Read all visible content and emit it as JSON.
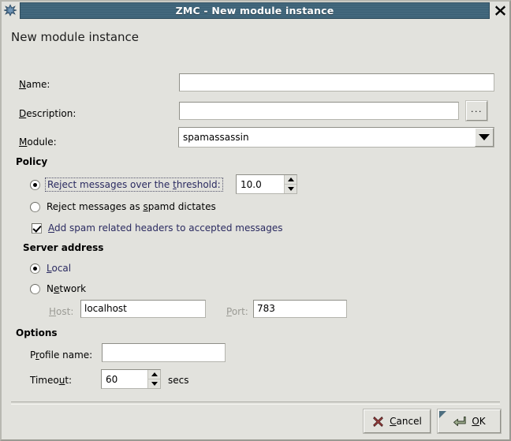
{
  "window": {
    "title": "ZMC - New module instance",
    "icon": "module-icon",
    "close_label": "close-icon"
  },
  "heading": "New module instance",
  "fields": {
    "name": {
      "label_pre": "",
      "label_acc": "N",
      "label_post": "ame:",
      "value": "",
      "placeholder": ""
    },
    "description": {
      "label_pre": "",
      "label_acc": "D",
      "label_post": "escription:",
      "value": "",
      "placeholder": "",
      "browse_label": "..."
    },
    "module": {
      "label_pre": "",
      "label_acc": "M",
      "label_post": "odule:",
      "value": "spamassassin",
      "options": [
        "spamassassin"
      ]
    }
  },
  "policy": {
    "title": "Policy",
    "reject_threshold": {
      "pre": "Reject messages over the ",
      "acc": "t",
      "post": "hreshold:",
      "selected": true,
      "focused": true,
      "value": "10.0"
    },
    "reject_spamd": {
      "pre": "Reject messages as ",
      "acc": "s",
      "post": "pamd dictates",
      "selected": false
    },
    "add_headers": {
      "pre": "",
      "acc": "A",
      "post": "dd spam related headers to accepted messages",
      "checked": true
    }
  },
  "server_address": {
    "title": "Server address",
    "local": {
      "pre": "",
      "acc": "L",
      "post": "ocal",
      "selected": true
    },
    "network": {
      "pre": "N",
      "acc": "e",
      "post": "twork",
      "selected": false
    },
    "host": {
      "pre": "",
      "acc": "H",
      "post": "ost:",
      "value": "localhost",
      "disabled": true
    },
    "port": {
      "pre": "",
      "acc": "P",
      "post": "ort:",
      "value": "783",
      "disabled": true
    }
  },
  "options": {
    "title": "Options",
    "profile_name": {
      "pre": "P",
      "acc": "r",
      "post": "ofile name:",
      "value": ""
    },
    "timeout": {
      "pre": "Timeo",
      "acc": "u",
      "post": "t:",
      "value": "60",
      "suffix": "secs"
    }
  },
  "buttons": {
    "cancel": {
      "pre": "",
      "acc": "C",
      "post": "ancel",
      "icon": "cancel-x-icon"
    },
    "ok": {
      "pre": "",
      "acc": "O",
      "post": "K",
      "icon": "ok-arrow-icon",
      "is_default": true
    }
  },
  "colors": {
    "titlebar": "#43687d",
    "dialog_bg": "#e2e2dd",
    "selected_text": "#2a2a60",
    "cancel_icon": "#9b3f3f",
    "ok_icon": "#8e9c80"
  }
}
